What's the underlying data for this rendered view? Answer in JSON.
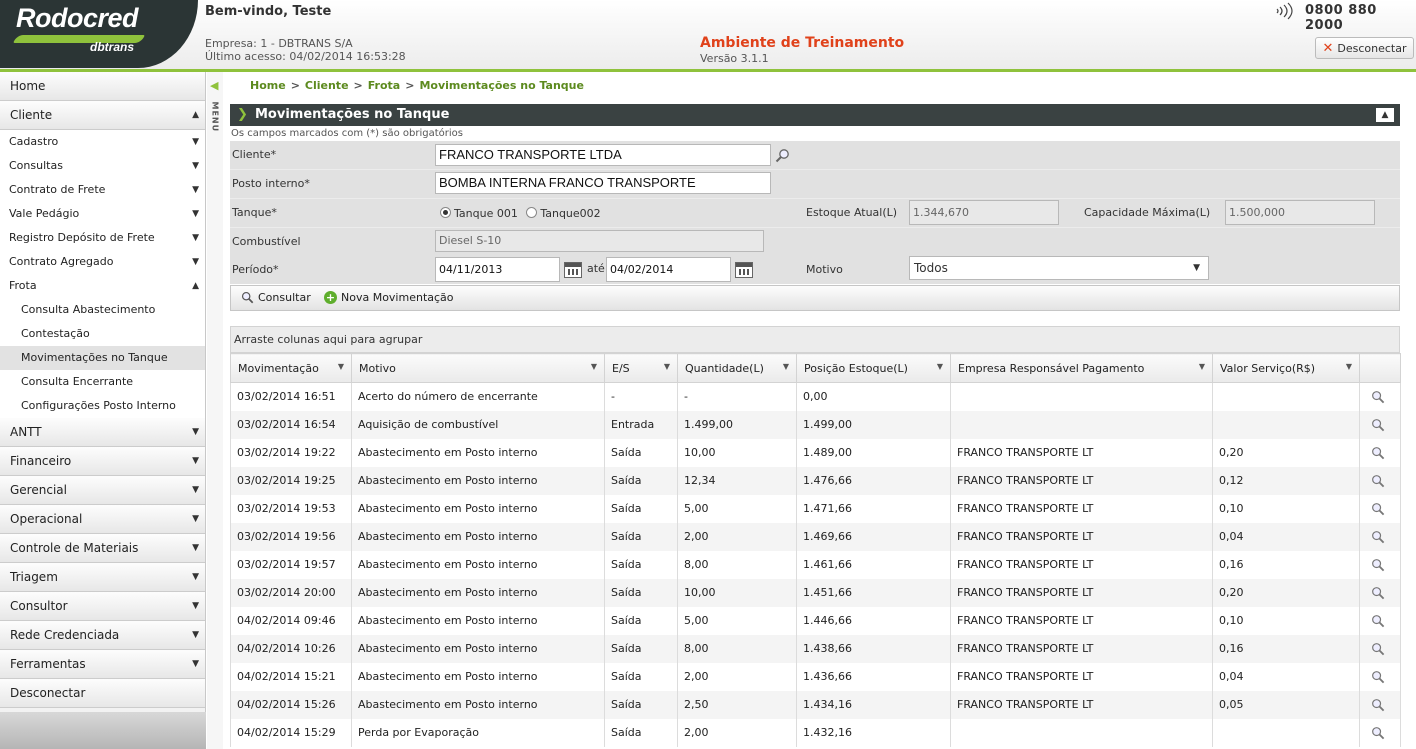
{
  "header": {
    "logo_text": "Rodocred",
    "logo_sub": "dbtrans",
    "welcome": "Bem-vindo, Teste",
    "empresa": "Empresa: 1 - DBTRANS S/A",
    "ultimo_acesso": "Último acesso: 04/02/2014 16:53:28",
    "ambiente": "Ambiente de Treinamento",
    "versao": "Versão 3.1.1",
    "phone": "0800 880 2000",
    "disconnect_label": "Desconectar",
    "accent_color": "#8fc23c",
    "alert_color": "#e0421b"
  },
  "sidebar": {
    "home": "Home",
    "cliente": "Cliente",
    "cliente_items": [
      "Cadastro",
      "Consultas",
      "Contrato de Frete",
      "Vale Pedágio",
      "Registro Depósito de Frete",
      "Contrato Agregado"
    ],
    "frota": "Frota",
    "frota_items": [
      "Consulta Abastecimento",
      "Contestação",
      "Movimentações no Tanque",
      "Consulta Encerrante",
      "Configurações Posto Interno"
    ],
    "bottom_items": [
      "ANTT",
      "Financeiro",
      "Gerencial",
      "Operacional",
      "Controle de Materiais",
      "Triagem",
      "Consultor",
      "Rede Credenciada",
      "Ferramentas"
    ],
    "desconectar": "Desconectar",
    "menu_label": "MENU"
  },
  "breadcrumb": [
    "Home",
    "Cliente",
    "Frota",
    "Movimentações no Tanque"
  ],
  "panel": {
    "title": "Movimentações no Tanque",
    "required_note": "Os campos marcados com (*) são obrigatórios"
  },
  "form": {
    "cliente_label": "Cliente*",
    "cliente_value": "FRANCO TRANSPORTE LTDA",
    "posto_label": "Posto interno*",
    "posto_value": "BOMBA INTERNA FRANCO TRANSPORTE",
    "tanque_label": "Tanque*",
    "tanque_option1": "Tanque 001",
    "tanque_option2": "Tanque002",
    "estoque_label": "Estoque Atual(L)",
    "estoque_value": "1.344,670",
    "capacidade_label": "Capacidade Máxima(L)",
    "capacidade_value": "1.500,000",
    "combustivel_label": "Combustível",
    "combustivel_value": "Diesel S-10",
    "periodo_label": "Período*",
    "periodo_inicio": "04/11/2013",
    "periodo_ate": "até",
    "periodo_fim": "04/02/2014",
    "motivo_label": "Motivo",
    "motivo_value": "Todos"
  },
  "toolbar": {
    "consultar": "Consultar",
    "nova": "Nova Movimentação"
  },
  "grid": {
    "group_hint": "Arraste colunas aqui para agrupar",
    "columns": [
      "Movimentação",
      "Motivo",
      "E/S",
      "Quantidade(L)",
      "Posição Estoque(L)",
      "Empresa Responsável Pagamento",
      "Valor Serviço(R$)"
    ],
    "rows": [
      [
        "03/02/2014 16:51",
        "Acerto do número de encerrante",
        "-",
        "-",
        "0,00",
        "",
        ""
      ],
      [
        "03/02/2014 16:54",
        "Aquisição de combustível",
        "Entrada",
        "1.499,00",
        "1.499,00",
        "",
        ""
      ],
      [
        "03/02/2014 19:22",
        "Abastecimento em Posto interno",
        "Saída",
        "10,00",
        "1.489,00",
        "FRANCO TRANSPORTE LT",
        "0,20"
      ],
      [
        "03/02/2014 19:25",
        "Abastecimento em Posto interno",
        "Saída",
        "12,34",
        "1.476,66",
        "FRANCO TRANSPORTE LT",
        "0,12"
      ],
      [
        "03/02/2014 19:53",
        "Abastecimento em Posto interno",
        "Saída",
        "5,00",
        "1.471,66",
        "FRANCO TRANSPORTE LT",
        "0,10"
      ],
      [
        "03/02/2014 19:56",
        "Abastecimento em Posto interno",
        "Saída",
        "2,00",
        "1.469,66",
        "FRANCO TRANSPORTE LT",
        "0,04"
      ],
      [
        "03/02/2014 19:57",
        "Abastecimento em Posto interno",
        "Saída",
        "8,00",
        "1.461,66",
        "FRANCO TRANSPORTE LT",
        "0,16"
      ],
      [
        "03/02/2014 20:00",
        "Abastecimento em Posto interno",
        "Saída",
        "10,00",
        "1.451,66",
        "FRANCO TRANSPORTE LT",
        "0,20"
      ],
      [
        "04/02/2014 09:46",
        "Abastecimento em Posto interno",
        "Saída",
        "5,00",
        "1.446,66",
        "FRANCO TRANSPORTE LT",
        "0,10"
      ],
      [
        "04/02/2014 10:26",
        "Abastecimento em Posto interno",
        "Saída",
        "8,00",
        "1.438,66",
        "FRANCO TRANSPORTE LT",
        "0,16"
      ],
      [
        "04/02/2014 15:21",
        "Abastecimento em Posto interno",
        "Saída",
        "2,00",
        "1.436,66",
        "FRANCO TRANSPORTE LT",
        "0,04"
      ],
      [
        "04/02/2014 15:26",
        "Abastecimento em Posto interno",
        "Saída",
        "2,50",
        "1.434,16",
        "FRANCO TRANSPORTE LT",
        "0,05"
      ],
      [
        "04/02/2014 15:29",
        "Perda por Evaporação",
        "Saída",
        "2,00",
        "1.432,16",
        "",
        ""
      ]
    ]
  }
}
